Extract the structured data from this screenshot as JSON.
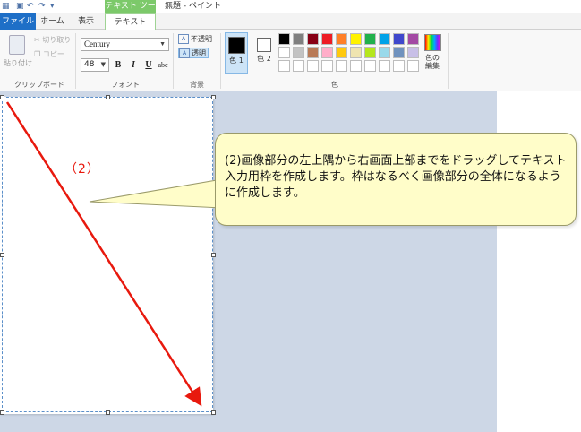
{
  "window": {
    "title": "無題 - ペイント",
    "context_tab_group": "テキスト ツール"
  },
  "tabs": [
    {
      "label": "ファイル"
    },
    {
      "label": "ホーム"
    },
    {
      "label": "表示"
    },
    {
      "label": "テキスト"
    }
  ],
  "clipboard": {
    "paste": "貼り付け",
    "cut": "切り取り",
    "copy": "コピー",
    "group_label": "クリップボード"
  },
  "font": {
    "family": "Century",
    "size": "48",
    "bold": "B",
    "italic": "I",
    "underline": "U",
    "strike": "abc",
    "group_label": "フォント"
  },
  "background": {
    "opaque": "不透明",
    "transparent": "透明",
    "group_label": "背景"
  },
  "colors": {
    "color1": "色 1",
    "color2": "色 2",
    "edit": "色の 編集",
    "group_label": "色",
    "color1_value": "#000000",
    "color2_value": "#ffffff",
    "palette": [
      "#000000",
      "#7f7f7f",
      "#880015",
      "#ed1c24",
      "#ff7f27",
      "#fff200",
      "#22b14c",
      "#00a2e8",
      "#3f48cc",
      "#a349a4",
      "#ffffff",
      "#c3c3c3",
      "#b97a57",
      "#ffaec9",
      "#ffc90e",
      "#efe4b0",
      "#b5e61d",
      "#99d9ea",
      "#7092be",
      "#c8bfe7",
      "#ffffff",
      "#ffffff",
      "#ffffff",
      "#ffffff",
      "#ffffff",
      "#ffffff",
      "#ffffff",
      "#ffffff",
      "#ffffff",
      "#ffffff"
    ]
  },
  "annotation": {
    "step": "（2）",
    "callout": "(2)画像部分の左上隅から右画面上部までをドラッグしてテキスト入力用枠を作成します。枠はなるべく画像部分の全体になるように作成します。"
  }
}
